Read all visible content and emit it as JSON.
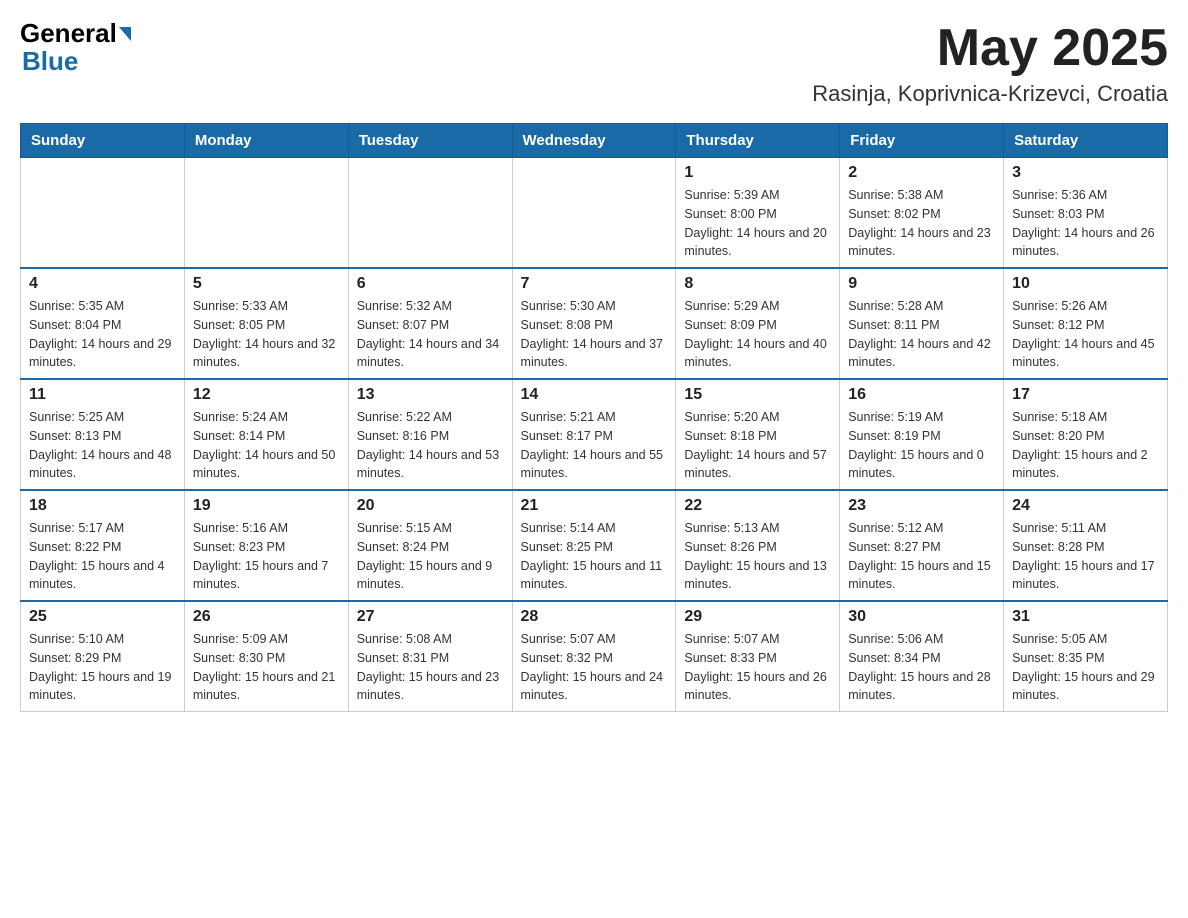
{
  "header": {
    "logo_general": "General",
    "logo_blue": "Blue",
    "month_title": "May 2025",
    "location": "Rasinja, Koprivnica-Krizevci, Croatia"
  },
  "days_of_week": [
    "Sunday",
    "Monday",
    "Tuesday",
    "Wednesday",
    "Thursday",
    "Friday",
    "Saturday"
  ],
  "weeks": [
    [
      {
        "day": "",
        "info": ""
      },
      {
        "day": "",
        "info": ""
      },
      {
        "day": "",
        "info": ""
      },
      {
        "day": "",
        "info": ""
      },
      {
        "day": "1",
        "info": "Sunrise: 5:39 AM\nSunset: 8:00 PM\nDaylight: 14 hours and 20 minutes."
      },
      {
        "day": "2",
        "info": "Sunrise: 5:38 AM\nSunset: 8:02 PM\nDaylight: 14 hours and 23 minutes."
      },
      {
        "day": "3",
        "info": "Sunrise: 5:36 AM\nSunset: 8:03 PM\nDaylight: 14 hours and 26 minutes."
      }
    ],
    [
      {
        "day": "4",
        "info": "Sunrise: 5:35 AM\nSunset: 8:04 PM\nDaylight: 14 hours and 29 minutes."
      },
      {
        "day": "5",
        "info": "Sunrise: 5:33 AM\nSunset: 8:05 PM\nDaylight: 14 hours and 32 minutes."
      },
      {
        "day": "6",
        "info": "Sunrise: 5:32 AM\nSunset: 8:07 PM\nDaylight: 14 hours and 34 minutes."
      },
      {
        "day": "7",
        "info": "Sunrise: 5:30 AM\nSunset: 8:08 PM\nDaylight: 14 hours and 37 minutes."
      },
      {
        "day": "8",
        "info": "Sunrise: 5:29 AM\nSunset: 8:09 PM\nDaylight: 14 hours and 40 minutes."
      },
      {
        "day": "9",
        "info": "Sunrise: 5:28 AM\nSunset: 8:11 PM\nDaylight: 14 hours and 42 minutes."
      },
      {
        "day": "10",
        "info": "Sunrise: 5:26 AM\nSunset: 8:12 PM\nDaylight: 14 hours and 45 minutes."
      }
    ],
    [
      {
        "day": "11",
        "info": "Sunrise: 5:25 AM\nSunset: 8:13 PM\nDaylight: 14 hours and 48 minutes."
      },
      {
        "day": "12",
        "info": "Sunrise: 5:24 AM\nSunset: 8:14 PM\nDaylight: 14 hours and 50 minutes."
      },
      {
        "day": "13",
        "info": "Sunrise: 5:22 AM\nSunset: 8:16 PM\nDaylight: 14 hours and 53 minutes."
      },
      {
        "day": "14",
        "info": "Sunrise: 5:21 AM\nSunset: 8:17 PM\nDaylight: 14 hours and 55 minutes."
      },
      {
        "day": "15",
        "info": "Sunrise: 5:20 AM\nSunset: 8:18 PM\nDaylight: 14 hours and 57 minutes."
      },
      {
        "day": "16",
        "info": "Sunrise: 5:19 AM\nSunset: 8:19 PM\nDaylight: 15 hours and 0 minutes."
      },
      {
        "day": "17",
        "info": "Sunrise: 5:18 AM\nSunset: 8:20 PM\nDaylight: 15 hours and 2 minutes."
      }
    ],
    [
      {
        "day": "18",
        "info": "Sunrise: 5:17 AM\nSunset: 8:22 PM\nDaylight: 15 hours and 4 minutes."
      },
      {
        "day": "19",
        "info": "Sunrise: 5:16 AM\nSunset: 8:23 PM\nDaylight: 15 hours and 7 minutes."
      },
      {
        "day": "20",
        "info": "Sunrise: 5:15 AM\nSunset: 8:24 PM\nDaylight: 15 hours and 9 minutes."
      },
      {
        "day": "21",
        "info": "Sunrise: 5:14 AM\nSunset: 8:25 PM\nDaylight: 15 hours and 11 minutes."
      },
      {
        "day": "22",
        "info": "Sunrise: 5:13 AM\nSunset: 8:26 PM\nDaylight: 15 hours and 13 minutes."
      },
      {
        "day": "23",
        "info": "Sunrise: 5:12 AM\nSunset: 8:27 PM\nDaylight: 15 hours and 15 minutes."
      },
      {
        "day": "24",
        "info": "Sunrise: 5:11 AM\nSunset: 8:28 PM\nDaylight: 15 hours and 17 minutes."
      }
    ],
    [
      {
        "day": "25",
        "info": "Sunrise: 5:10 AM\nSunset: 8:29 PM\nDaylight: 15 hours and 19 minutes."
      },
      {
        "day": "26",
        "info": "Sunrise: 5:09 AM\nSunset: 8:30 PM\nDaylight: 15 hours and 21 minutes."
      },
      {
        "day": "27",
        "info": "Sunrise: 5:08 AM\nSunset: 8:31 PM\nDaylight: 15 hours and 23 minutes."
      },
      {
        "day": "28",
        "info": "Sunrise: 5:07 AM\nSunset: 8:32 PM\nDaylight: 15 hours and 24 minutes."
      },
      {
        "day": "29",
        "info": "Sunrise: 5:07 AM\nSunset: 8:33 PM\nDaylight: 15 hours and 26 minutes."
      },
      {
        "day": "30",
        "info": "Sunrise: 5:06 AM\nSunset: 8:34 PM\nDaylight: 15 hours and 28 minutes."
      },
      {
        "day": "31",
        "info": "Sunrise: 5:05 AM\nSunset: 8:35 PM\nDaylight: 15 hours and 29 minutes."
      }
    ]
  ]
}
